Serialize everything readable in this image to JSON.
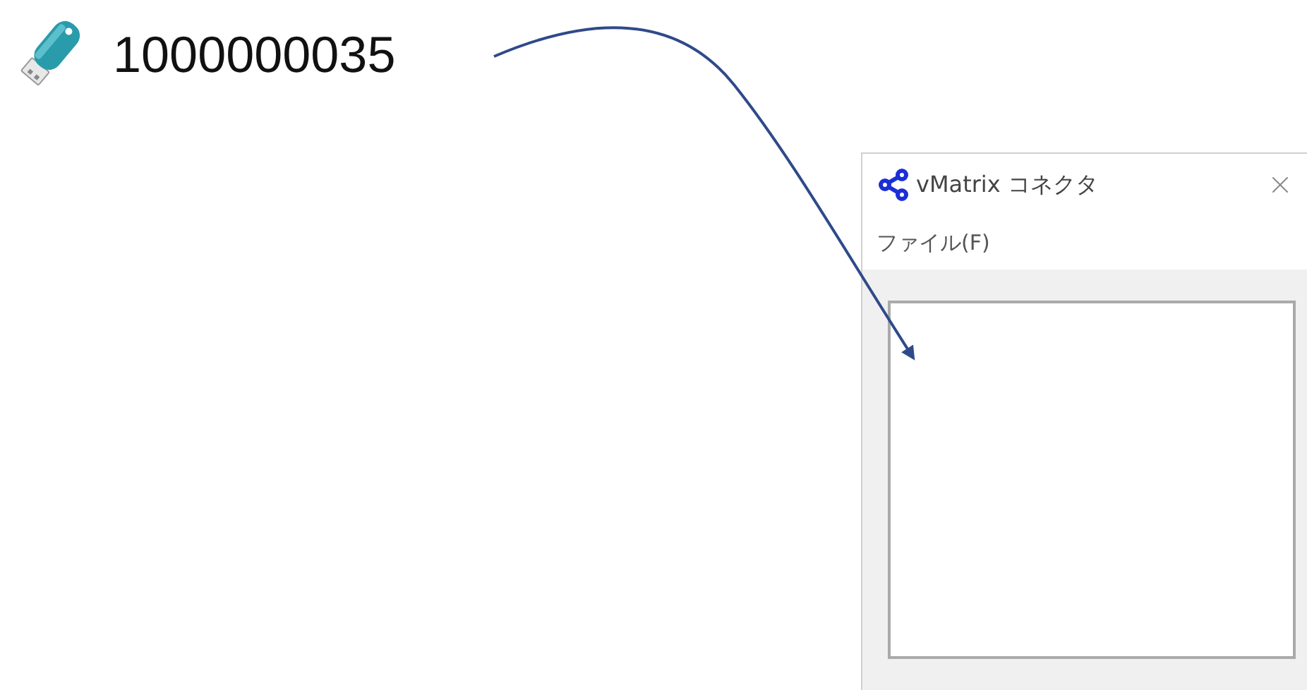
{
  "device": {
    "label": "1000000035"
  },
  "window": {
    "title": "vMatrix コネクタ",
    "menu": [
      "ファイル(F)"
    ]
  }
}
